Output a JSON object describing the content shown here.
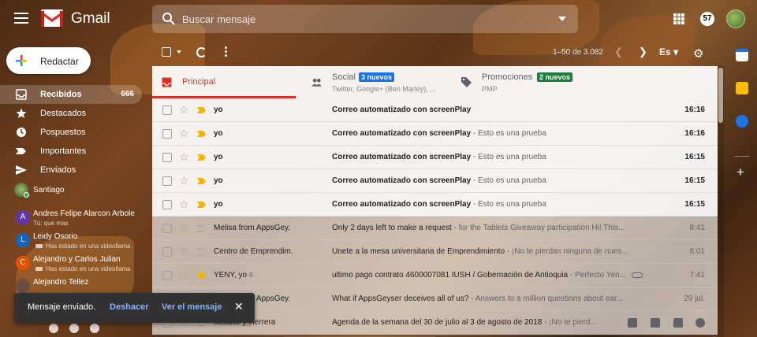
{
  "header": {
    "brand": "Gmail",
    "search_placeholder": "Buscar mensaje",
    "notifications": "57"
  },
  "compose": {
    "label": "Redactar"
  },
  "nav": [
    {
      "label": "Recibidos",
      "count": "666",
      "icon": "inbox-icon"
    },
    {
      "label": "Destacados",
      "icon": "star-icon"
    },
    {
      "label": "Pospuestos",
      "icon": "clock-icon"
    },
    {
      "label": "Importantes",
      "icon": "important-icon"
    },
    {
      "label": "Enviados",
      "icon": "send-icon"
    }
  ],
  "hangouts": {
    "user": "Santiago",
    "contacts": [
      {
        "initial": "A",
        "name": "Andres Felipe Alarcon Arbole",
        "status": "Tú: que mas",
        "color": "#5e35b1"
      },
      {
        "initial": "L",
        "name": "Leidy Osorio",
        "status": "Has estado en una videollama",
        "color": "#1565c0"
      },
      {
        "initial": "C",
        "name": "Alejandro y Carlos Julian",
        "status": "Has estado en una videollama",
        "color": "#e65100"
      },
      {
        "initial": "",
        "name": "Alejandro Tellez",
        "status": "",
        "color": "#6d4c41"
      }
    ]
  },
  "toolbar": {
    "pager": "1–50 de 3.082",
    "lang": "Es"
  },
  "tabs": [
    {
      "label": "Principal"
    },
    {
      "label": "Social",
      "badge": "3 nuevos",
      "sub": "Twitter, Google+ (Ben Marley), ..."
    },
    {
      "label": "Promociones",
      "badge": "2 nuevos",
      "sub": "PMP"
    }
  ],
  "emails": [
    {
      "sender": "yo",
      "count": "",
      "subject": "Correo automatizado con screenPlay",
      "snippet": "",
      "date": "16:16",
      "unread": true,
      "important": true
    },
    {
      "sender": "yo",
      "count": "",
      "subject": "Correo automatizado con screenPlay",
      "snippet": " - Esto es una prueba",
      "date": "16:16",
      "unread": true,
      "important": true
    },
    {
      "sender": "yo",
      "count": "",
      "subject": "Correo automatizado con screenPlay",
      "snippet": " - Esto es una prueba",
      "date": "16:15",
      "unread": true,
      "important": true
    },
    {
      "sender": "yo",
      "count": "",
      "subject": "Correo automatizado con screenPlay",
      "snippet": " - Esto es una prueba",
      "date": "16:15",
      "unread": true,
      "important": true
    },
    {
      "sender": "yo",
      "count": "",
      "subject": "Correo automatizado con screenPlay",
      "snippet": " - Esto es una prueba",
      "date": "16:15",
      "unread": true,
      "important": true
    },
    {
      "sender": "Melisa from AppsGey.",
      "count": "",
      "subject": "Only 2 days left to make a request",
      "snippet": " - for the Tablets Giveaway participation Hi! This...",
      "date": "8:41",
      "unread": false,
      "important": false
    },
    {
      "sender": "Centro de Emprendim.",
      "count": "",
      "subject": "Únete a la mesa universitaria de Emprendimiento",
      "snippet": " - ¡No te pierdas ninguna de nues...",
      "date": "8:01",
      "unread": false,
      "important": false
    },
    {
      "sender": "YENY, yo",
      "count": "6",
      "subject": "ultimo pago contrato 4600007081 IUSH / Gobernación de Antioquia",
      "snippet": " - Perfecto Yen...",
      "date": "7:41",
      "unread": false,
      "important": true,
      "attachment": true
    },
    {
      "sender": "Melisa from AppsGey.",
      "count": "",
      "subject": "What if AppsGeyser deceives all of us?",
      "snippet": " - Answers to a million questions about ear...",
      "date": "29 jul.",
      "unread": false,
      "important": false
    },
    {
      "sender": "Salazar y Herrera",
      "count": "",
      "subject": "Agenda de la semana del 30 de julio al 3 de agosto de 2018",
      "snippet": " - ¡No te pierd...",
      "date": "",
      "unread": false,
      "important": false,
      "hover": true
    }
  ],
  "snackbar": {
    "message": "Mensaje enviado.",
    "undo": "Deshacer",
    "view": "Ver el mensaje"
  }
}
